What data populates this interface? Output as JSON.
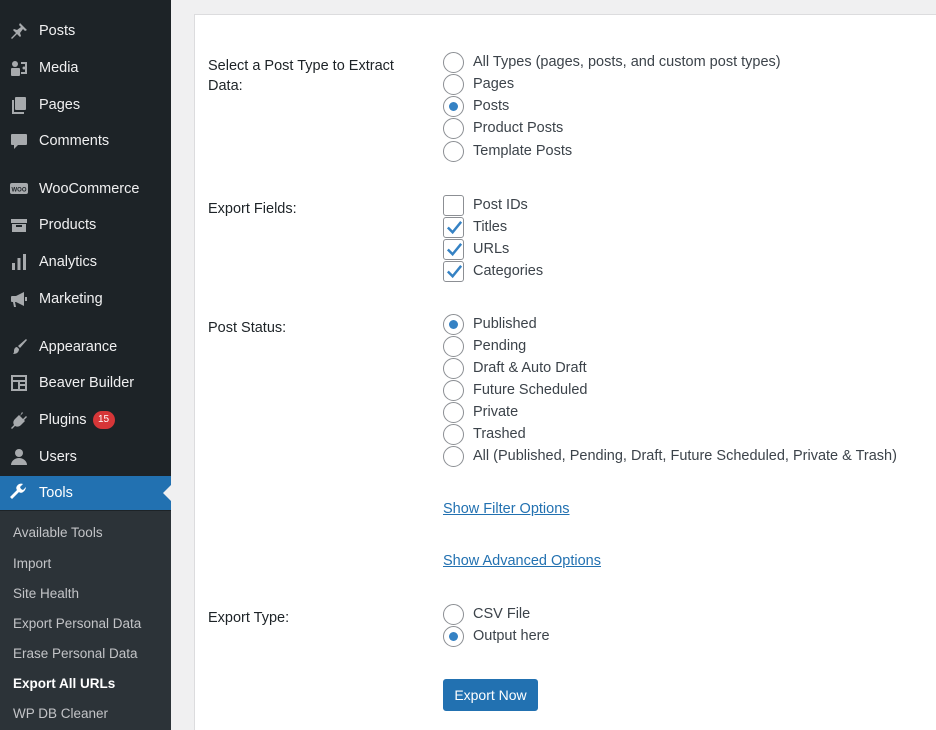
{
  "sidebar": {
    "items": [
      {
        "label": "Posts",
        "icon": "pin-icon"
      },
      {
        "label": "Media",
        "icon": "media-icon"
      },
      {
        "label": "Pages",
        "icon": "pages-icon"
      },
      {
        "label": "Comments",
        "icon": "comments-icon"
      },
      {
        "label": "WooCommerce",
        "icon": "woocommerce-icon"
      },
      {
        "label": "Products",
        "icon": "products-icon"
      },
      {
        "label": "Analytics",
        "icon": "analytics-icon"
      },
      {
        "label": "Marketing",
        "icon": "megaphone-icon"
      },
      {
        "label": "Appearance",
        "icon": "paintbrush-icon"
      },
      {
        "label": "Beaver Builder",
        "icon": "layout-icon"
      },
      {
        "label": "Plugins",
        "icon": "plugins-icon",
        "badge": "15"
      },
      {
        "label": "Users",
        "icon": "users-icon"
      },
      {
        "label": "Tools",
        "icon": "wrench-icon",
        "active": true
      }
    ],
    "submenu": [
      {
        "label": "Available Tools"
      },
      {
        "label": "Import"
      },
      {
        "label": "Site Health"
      },
      {
        "label": "Export Personal Data"
      },
      {
        "label": "Erase Personal Data"
      },
      {
        "label": "Export All URLs",
        "current": true
      },
      {
        "label": "WP DB Cleaner"
      }
    ]
  },
  "form": {
    "post_type": {
      "label": "Select a Post Type to Extract Data:",
      "options": [
        "All Types (pages, posts, and custom post types)",
        "Pages",
        "Posts",
        "Product Posts",
        "Template Posts"
      ],
      "selected": "Posts"
    },
    "export_fields": {
      "label": "Export Fields:",
      "options": [
        "Post IDs",
        "Titles",
        "URLs",
        "Categories"
      ],
      "checked": [
        "Titles",
        "URLs",
        "Categories"
      ]
    },
    "post_status": {
      "label": "Post Status:",
      "options": [
        "Published",
        "Pending",
        "Draft & Auto Draft",
        "Future Scheduled",
        "Private",
        "Trashed",
        "All (Published, Pending, Draft, Future Scheduled, Private & Trash)"
      ],
      "selected": "Published"
    },
    "show_filter_link": "Show Filter Options",
    "show_advanced_link": "Show Advanced Options",
    "export_type": {
      "label": "Export Type:",
      "options": [
        "CSV File",
        "Output here"
      ],
      "selected": "Output here"
    },
    "submit_label": "Export Now"
  },
  "colors": {
    "sidebar_bg": "#1d2327",
    "submenu_bg": "#2c3338",
    "accent": "#2271b1",
    "badge": "#d63638"
  }
}
